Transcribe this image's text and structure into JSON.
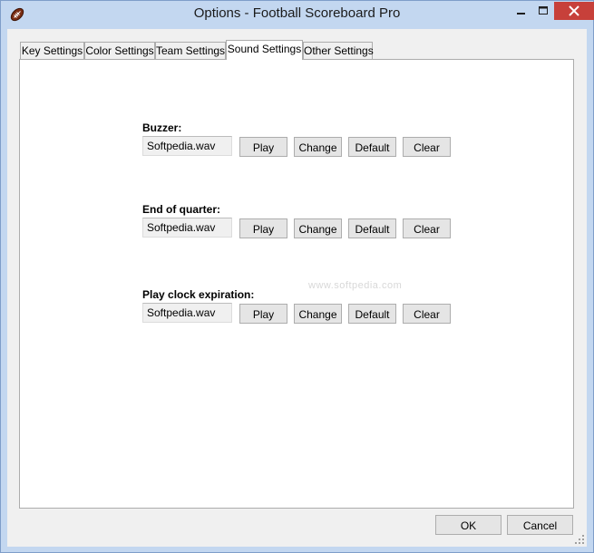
{
  "window": {
    "title": "Options - Football Scoreboard Pro",
    "close_color": "#c7403a",
    "app_icon": "football-icon"
  },
  "tabs": [
    {
      "label": "Key Settings",
      "active": false
    },
    {
      "label": "Color Settings",
      "active": false
    },
    {
      "label": "Team Settings",
      "active": false
    },
    {
      "label": "Sound Settings",
      "active": true
    },
    {
      "label": "Other Settings",
      "active": false
    }
  ],
  "sounds": [
    {
      "label": "Buzzer:",
      "file": "Softpedia.wav"
    },
    {
      "label": "End of quarter:",
      "file": "Softpedia.wav"
    },
    {
      "label": "Play clock expiration:",
      "file": "Softpedia.wav"
    }
  ],
  "buttons": {
    "play": "Play",
    "change": "Change",
    "default": "Default",
    "clear": "Clear"
  },
  "watermark": "www.softpedia.com",
  "footer": {
    "ok": "OK",
    "cancel": "Cancel"
  }
}
